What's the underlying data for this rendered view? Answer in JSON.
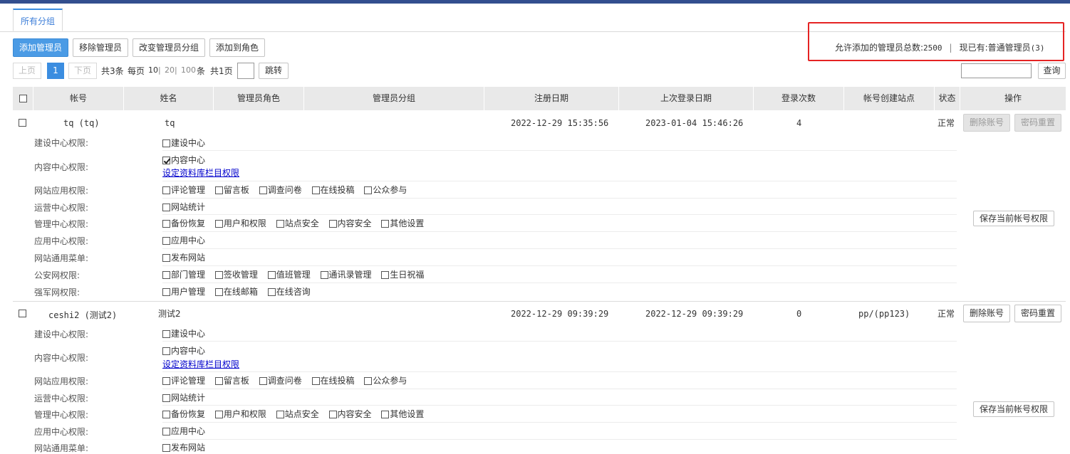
{
  "tab": "所有分组",
  "toolbar": {
    "add_admin": "添加管理员",
    "remove_admin": "移除管理员",
    "change_group": "改变管理员分组",
    "add_to_role": "添加到角色"
  },
  "pager": {
    "prev": "上页",
    "current": "1",
    "next": "下页",
    "total": "共3条",
    "per_page_label": "每页",
    "sizes": [
      "10",
      "20",
      "100"
    ],
    "unit": "条",
    "pages": "共1页",
    "jump": "跳转"
  },
  "info": {
    "allowed_label": "允许添加的管理员总数:",
    "allowed_value": "2500",
    "separator": "|",
    "existing_label": "现已有:普通管理员",
    "existing_value": "(3)"
  },
  "search": {
    "button": "查询"
  },
  "columns": [
    "帐号",
    "姓名",
    "管理员角色",
    "管理员分组",
    "注册日期",
    "上次登录日期",
    "登录次数",
    "帐号创建站点",
    "状态",
    "操作"
  ],
  "rows": [
    {
      "account": "tq (tq)",
      "name": "tq",
      "reg_date": "2022-12-29 15:35:56",
      "last_login": "2023-01-04 15:46:26",
      "login_count": "4",
      "site": "",
      "status": "正常",
      "delete_btn": "删除账号",
      "reset_btn": "密码重置",
      "save_btn": "保存当前帐号权限",
      "perms": [
        {
          "label": "建设中心权限:",
          "items": [
            {
              "text": "建设中心",
              "checked": false
            }
          ]
        },
        {
          "label": "内容中心权限:",
          "items": [
            {
              "text": "内容中心",
              "checked": true
            }
          ],
          "link": "设定资料库栏目权限"
        },
        {
          "label": "网站应用权限:",
          "items": [
            {
              "text": "评论管理"
            },
            {
              "text": "留言板"
            },
            {
              "text": "调查问卷"
            },
            {
              "text": "在线投稿"
            },
            {
              "text": "公众参与"
            }
          ]
        },
        {
          "label": "运营中心权限:",
          "items": [
            {
              "text": "网站统计"
            }
          ]
        },
        {
          "label": "管理中心权限:",
          "items": [
            {
              "text": "备份恢复"
            },
            {
              "text": "用户和权限"
            },
            {
              "text": "站点安全"
            },
            {
              "text": "内容安全"
            },
            {
              "text": "其他设置"
            }
          ]
        },
        {
          "label": "应用中心权限:",
          "items": [
            {
              "text": "应用中心"
            }
          ]
        },
        {
          "label": "网站通用菜单:",
          "items": [
            {
              "text": "发布网站"
            }
          ]
        },
        {
          "label": "公安网权限:",
          "items": [
            {
              "text": "部门管理"
            },
            {
              "text": "签收管理"
            },
            {
              "text": "值班管理"
            },
            {
              "text": "通讯录管理"
            },
            {
              "text": "生日祝福"
            }
          ]
        },
        {
          "label": "强军网权限:",
          "items": [
            {
              "text": "用户管理"
            },
            {
              "text": "在线邮箱"
            },
            {
              "text": "在线咨询"
            }
          ]
        }
      ]
    },
    {
      "account": "ceshi2 (测试2)",
      "name": "测试2",
      "reg_date": "2022-12-29 09:39:29",
      "last_login": "2022-12-29 09:39:29",
      "login_count": "0",
      "site": "pp/(pp123)",
      "status": "正常",
      "delete_btn": "删除账号",
      "reset_btn": "密码重置",
      "save_btn": "保存当前帐号权限",
      "perms": [
        {
          "label": "建设中心权限:",
          "items": [
            {
              "text": "建设中心"
            }
          ]
        },
        {
          "label": "内容中心权限:",
          "items": [
            {
              "text": "内容中心"
            }
          ],
          "link": "设定资料库栏目权限"
        },
        {
          "label": "网站应用权限:",
          "items": [
            {
              "text": "评论管理"
            },
            {
              "text": "留言板"
            },
            {
              "text": "调查问卷"
            },
            {
              "text": "在线投稿"
            },
            {
              "text": "公众参与"
            }
          ]
        },
        {
          "label": "运营中心权限:",
          "items": [
            {
              "text": "网站统计"
            }
          ]
        },
        {
          "label": "管理中心权限:",
          "items": [
            {
              "text": "备份恢复"
            },
            {
              "text": "用户和权限"
            },
            {
              "text": "站点安全"
            },
            {
              "text": "内容安全"
            },
            {
              "text": "其他设置"
            }
          ]
        },
        {
          "label": "应用中心权限:",
          "items": [
            {
              "text": "应用中心"
            }
          ]
        },
        {
          "label": "网站通用菜单:",
          "items": [
            {
              "text": "发布网站"
            }
          ]
        }
      ]
    }
  ],
  "colors": {
    "accent": "#3b8de0",
    "topbar": "#334f8f",
    "highlight": "#e52323"
  }
}
